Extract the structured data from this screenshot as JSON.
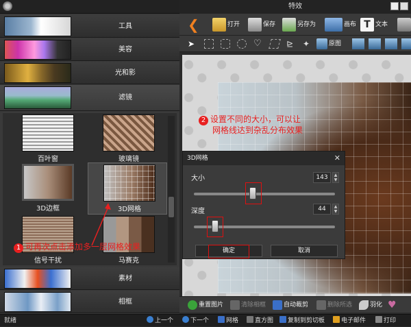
{
  "window": {
    "title": "特效"
  },
  "left_panel": {
    "categories": [
      {
        "label": "工具"
      },
      {
        "label": "美容"
      },
      {
        "label": "光和影"
      },
      {
        "label": "滤镜"
      },
      {
        "label": "素材"
      },
      {
        "label": "相框"
      }
    ],
    "filters": [
      {
        "label": "百叶窗"
      },
      {
        "label": "玻璃镜"
      },
      {
        "label": "3D边框"
      },
      {
        "label": "3D网格"
      },
      {
        "label": "信号干扰"
      },
      {
        "label": "马赛克"
      }
    ],
    "selected_filter": "3D网格"
  },
  "toolbar": {
    "open": "打开",
    "save": "保存",
    "save_as": "另存为",
    "canvas": "画布",
    "text": "文本"
  },
  "toolbar2": {
    "original": "原图"
  },
  "dialog": {
    "title": "3D网格",
    "size_label": "大小",
    "size_value": "143",
    "depth_label": "深度",
    "depth_value": "44",
    "ok": "确定",
    "cancel": "取消"
  },
  "bottom_toolbar": {
    "reset": "重置图片",
    "clear": "清除相框",
    "autocrop": "自动裁剪",
    "delete": "删除所选",
    "feather": "羽化"
  },
  "status": {
    "ready": "就绪",
    "prev": "上一个",
    "next": "下一个",
    "grid": "网格",
    "histogram": "直方图",
    "copy": "复制到剪切板",
    "email": "电子邮件",
    "print": "打印"
  },
  "annotations": {
    "note1_num": "1",
    "note1": "可再次点击添加多一层网格效果",
    "note2_num": "2",
    "note2_line1": "设置不同的大小，可以让",
    "note2_line2": "网格线达到杂乱分布效果"
  },
  "colors": {
    "annotation": "#e82020",
    "panel": "#3a3a3a"
  }
}
